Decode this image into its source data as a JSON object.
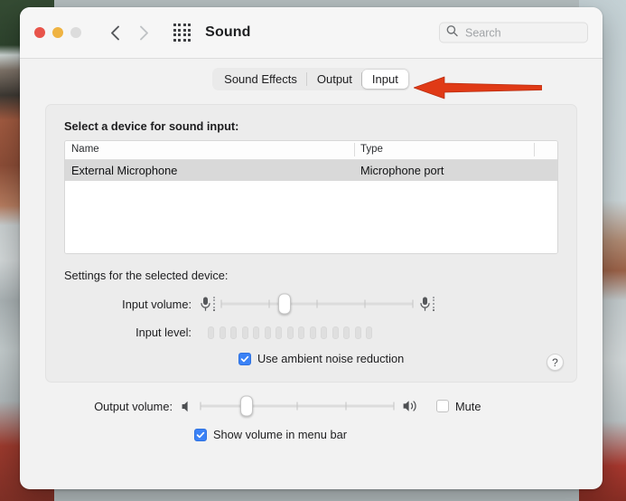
{
  "window": {
    "title": "Sound",
    "traffic_lights": [
      "close",
      "minimize",
      "zoom"
    ],
    "nav_back": "back-chevron",
    "nav_forward": "forward-chevron",
    "grid_button": "all-preferences-grid",
    "search": {
      "placeholder": "Search",
      "value": "",
      "icon": "search-icon"
    }
  },
  "tabs": [
    {
      "label": "Sound Effects",
      "active": false
    },
    {
      "label": "Output",
      "active": false
    },
    {
      "label": "Input",
      "active": true
    }
  ],
  "annotation": {
    "type": "arrow",
    "points_to": "Input",
    "color": "#e03a16"
  },
  "panel": {
    "title": "Select a device for sound input:",
    "table": {
      "columns": [
        "Name",
        "Type"
      ],
      "rows": [
        {
          "name": "External Microphone",
          "type": "Microphone port",
          "selected": true
        }
      ]
    },
    "settings_title": "Settings for the selected device:",
    "input_volume": {
      "label": "Input volume:",
      "value_percent": 33,
      "left_icon": "microphone-quiet-icon",
      "right_icon": "microphone-loud-icon",
      "tick_count": 5
    },
    "input_level": {
      "label": "Input level:",
      "segments": 15,
      "active_segments": 0
    },
    "ambient_noise": {
      "label": "Use ambient noise reduction",
      "checked": true
    },
    "help_button": "?"
  },
  "footer": {
    "output_volume": {
      "label": "Output volume:",
      "value_percent": 24,
      "left_icon": "speaker-mute-icon",
      "right_icon": "speaker-loud-icon",
      "tick_count": 5
    },
    "mute": {
      "label": "Mute",
      "checked": false
    },
    "show_volume": {
      "label": "Show volume in menu bar",
      "checked": true
    }
  },
  "colors": {
    "accent": "#3b82f6",
    "annotation_red": "#e03a16",
    "window_bg": "#f2f2f2",
    "panel_bg": "#ececec",
    "row_selected": "#d9d9d9"
  }
}
